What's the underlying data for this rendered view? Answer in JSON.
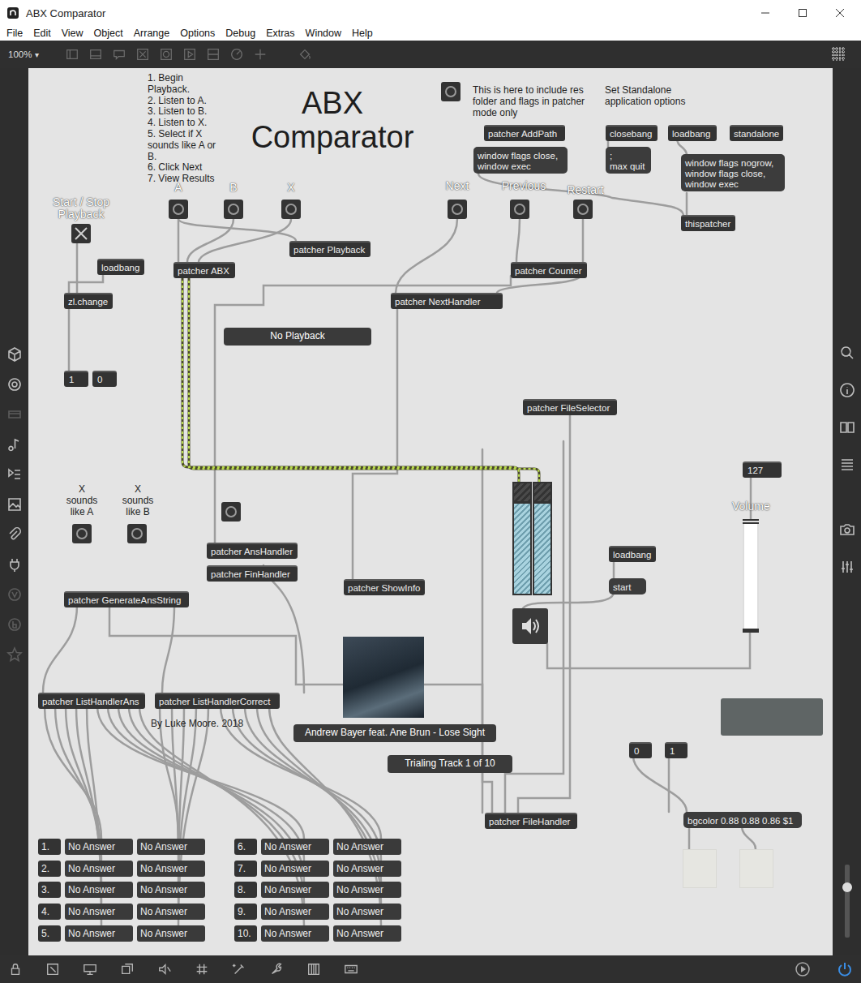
{
  "window": {
    "title": "ABX Comparator"
  },
  "menu": [
    "File",
    "Edit",
    "View",
    "Object",
    "Arrange",
    "Options",
    "Debug",
    "Extras",
    "Window",
    "Help"
  ],
  "toolbar": {
    "zoom": "100%",
    "zoom_arrow": "▾"
  },
  "patcher": {
    "title": "ABX Comparator",
    "instructions": [
      "1. Begin Playback.",
      "2. Listen to A.",
      "3. Listen to B.",
      "4. Listen to X.",
      "5. Select if X sounds like A or B.",
      "6. Click Next",
      "7. View Results"
    ],
    "comments": [
      "This is here to include res folder and flags in patcher mode only",
      "Set Standalone application options",
      "A",
      "B",
      "X",
      "Next",
      "Previous",
      "Restart",
      "Start / Stop Playback",
      "X sounds like A",
      "X sounds like B",
      "By Luke Moore. 2018"
    ],
    "objects": [
      {
        "text": "patcher AddPath",
        "kind": "object"
      },
      {
        "text": "closebang",
        "kind": "object"
      },
      {
        "text": "loadbang",
        "kind": "object"
      },
      {
        "text": "standalone",
        "kind": "object"
      },
      {
        "text": "window flags close,\nwindow exec",
        "kind": "message"
      },
      {
        "text": ";\nmax quit",
        "kind": "message"
      },
      {
        "text": "window flags nogrow,\nwindow flags close,\nwindow exec",
        "kind": "message"
      },
      {
        "text": "thispatcher",
        "kind": "object"
      },
      {
        "text": "patcher Playback",
        "kind": "object"
      },
      {
        "text": "loadbang",
        "kind": "object"
      },
      {
        "text": "patcher ABX",
        "kind": "object"
      },
      {
        "text": "patcher Counter",
        "kind": "object"
      },
      {
        "text": "zl.change",
        "kind": "object"
      },
      {
        "text": "patcher NextHandler",
        "kind": "object"
      },
      {
        "text": "1",
        "kind": "number"
      },
      {
        "text": "0",
        "kind": "number"
      },
      {
        "text": "patcher FileSelector",
        "kind": "object"
      },
      {
        "text": "patcher AnsHandler",
        "kind": "object"
      },
      {
        "text": "loadbang",
        "kind": "object"
      },
      {
        "text": "patcher FinHandler",
        "kind": "object"
      },
      {
        "text": "start",
        "kind": "message"
      },
      {
        "text": "patcher ShowInfo",
        "kind": "object"
      },
      {
        "text": "patcher GenerateAnsString",
        "kind": "object"
      },
      {
        "text": "patcher ListHandlerAns",
        "kind": "object"
      },
      {
        "text": "patcher ListHandlerCorrect",
        "kind": "object"
      },
      {
        "text": "0",
        "kind": "number"
      },
      {
        "text": "1",
        "kind": "number"
      },
      {
        "text": "patcher FileHandler",
        "kind": "object"
      },
      {
        "text": "bgcolor 0.88 0.88 0.86 $1",
        "kind": "message"
      },
      {
        "text": "No Playback",
        "kind": "display"
      },
      {
        "text": "Andrew Bayer feat. Ane Brun - Lose Sight",
        "kind": "display"
      },
      {
        "text": "Trialing Track 1 of 10",
        "kind": "display"
      }
    ],
    "toggle": {
      "checked": true
    },
    "meters": [
      {
        "level": 0
      },
      {
        "level": 0
      }
    ],
    "volume": {
      "label": "Volume",
      "reading": "127",
      "level": 1
    },
    "results": [
      {
        "number": "1.",
        "answer": "No Answer",
        "correct": "No Answer"
      },
      {
        "number": "2.",
        "answer": "No Answer",
        "correct": "No Answer"
      },
      {
        "number": "3.",
        "answer": "No Answer",
        "correct": "No Answer"
      },
      {
        "number": "4.",
        "answer": "No Answer",
        "correct": "No Answer"
      },
      {
        "number": "5.",
        "answer": "No Answer",
        "correct": "No Answer"
      },
      {
        "number": "6.",
        "answer": "No Answer",
        "correct": "No Answer"
      },
      {
        "number": "7.",
        "answer": "No Answer",
        "correct": "No Answer"
      },
      {
        "number": "8.",
        "answer": "No Answer",
        "correct": "No Answer"
      },
      {
        "number": "9.",
        "answer": "No Answer",
        "correct": "No Answer"
      },
      {
        "number": "10.",
        "answer": "No Answer",
        "correct": "No Answer"
      }
    ]
  }
}
